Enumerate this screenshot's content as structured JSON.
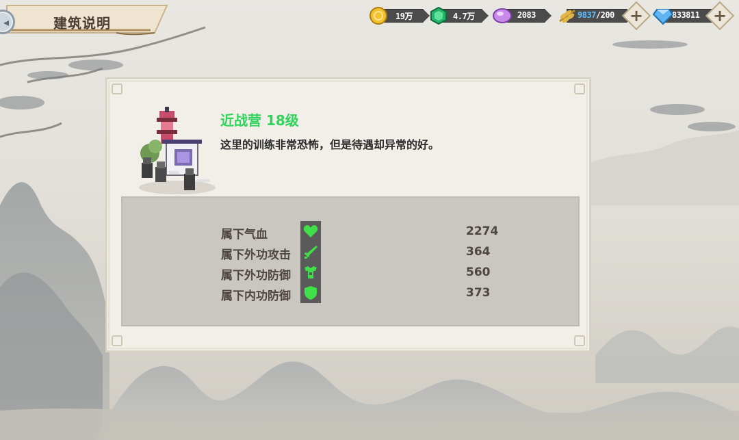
{
  "header": {
    "title": "建筑说明",
    "back_icon": "back-arrow-icon"
  },
  "resources": [
    {
      "id": "gold",
      "icon": "gold-coin-icon",
      "value": "19万",
      "color": "#f2c230"
    },
    {
      "id": "jade",
      "icon": "green-gem-icon",
      "value": "4.7万",
      "color": "#27b36a"
    },
    {
      "id": "crystal",
      "icon": "purple-crystal-icon",
      "value": "2083",
      "color": "#c98bea"
    },
    {
      "id": "stamina",
      "icon": "wheat-icon",
      "value_current": "9837",
      "value_sep": "/",
      "value_max": "200",
      "color": "#e0b64a"
    },
    {
      "id": "diamond",
      "icon": "diamond-icon",
      "value": "833811",
      "color": "#5fb5f2"
    }
  ],
  "building": {
    "name": "近战营 18级",
    "description": "这里的训练非常恐怖，但是待遇却异常的好。",
    "art_icon": "melee-camp-building-icon"
  },
  "stats": [
    {
      "label": "属下气血",
      "icon": "heart-icon",
      "value": "2274"
    },
    {
      "label": "属下外功攻击",
      "icon": "sword-icon",
      "value": "364"
    },
    {
      "label": "属下外功防御",
      "icon": "armor-icon",
      "value": "560"
    },
    {
      "label": "属下内功防御",
      "icon": "shield-icon",
      "value": "373"
    }
  ],
  "colors": {
    "name_green": "#2fd35a",
    "stat_icon_green": "#3fe04a",
    "panel_bg": "#f2efe9",
    "stats_bg": "#cac6c0"
  }
}
